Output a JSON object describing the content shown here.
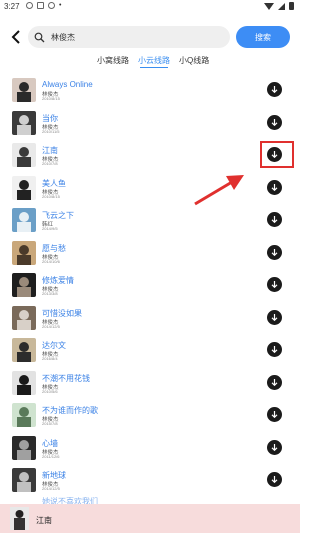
{
  "status_bar": {
    "time": "3:27"
  },
  "search": {
    "query": "林俊杰",
    "button_label": "搜索"
  },
  "tabs": [
    {
      "label": "小窝线路",
      "active": false
    },
    {
      "label": "小云线路",
      "active": true
    },
    {
      "label": "小Q线路",
      "active": false
    }
  ],
  "songs": [
    {
      "title": "Always Online",
      "artist": "林俊杰",
      "date": "2010/8/15"
    },
    {
      "title": "当你",
      "artist": "林俊杰",
      "date": "2010/11/5"
    },
    {
      "title": "江南",
      "artist": "林俊杰",
      "date": "2010/7/8"
    },
    {
      "title": "美人鱼",
      "artist": "林俊杰",
      "date": "2010/8/15"
    },
    {
      "title": "飞云之下",
      "artist": "韩红",
      "date": "2014/9/5"
    },
    {
      "title": "愿与愁",
      "artist": "林俊杰",
      "date": "2014/10/6"
    },
    {
      "title": "修炼爱情",
      "artist": "林俊杰",
      "date": "2013/3/8"
    },
    {
      "title": "可惜没如果",
      "artist": "林俊杰",
      "date": "2014/12/5"
    },
    {
      "title": "达尔文",
      "artist": "林俊杰",
      "date": "2016/8/4"
    },
    {
      "title": "不潮不用花钱",
      "artist": "林俊杰",
      "date": "2010/5/6"
    },
    {
      "title": "不为谁而作的歌",
      "artist": "林俊杰",
      "date": "2015/7/8"
    },
    {
      "title": "心墙",
      "artist": "林俊杰",
      "date": "2011/12/6"
    },
    {
      "title": "新地球",
      "artist": "林俊杰",
      "date": "2014/12/5"
    }
  ],
  "partial_row_title": "她说不喜欢我们",
  "now_playing": {
    "title": "江南"
  },
  "highlight_color": "#e0302e",
  "accent_color": "#3d8df5"
}
